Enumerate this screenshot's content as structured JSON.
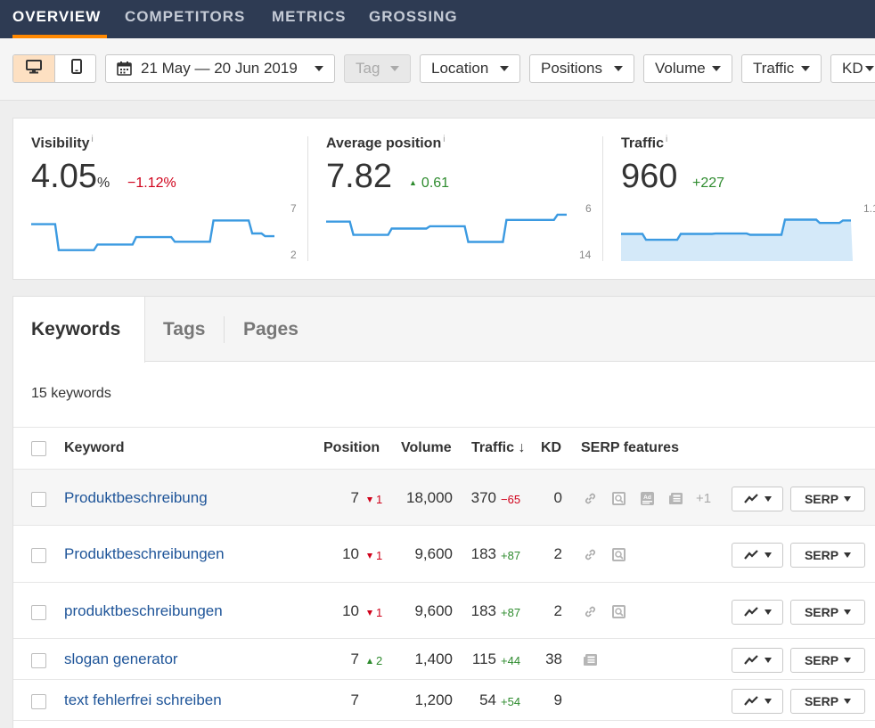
{
  "nav": {
    "items": [
      "OVERVIEW",
      "COMPETITORS",
      "METRICS",
      "GROSSING"
    ],
    "active": "OVERVIEW"
  },
  "toolbar": {
    "devices": [
      "desktop-icon",
      "mobile-icon"
    ],
    "date_range": "21 May — 20 Jun 2019",
    "tag": "Tag",
    "location": "Location",
    "positions": "Positions",
    "volume": "Volume",
    "traffic": "Traffic",
    "kd": "KD"
  },
  "overview": {
    "visibility": {
      "title": "Visibility",
      "info": "i",
      "value": "4.05",
      "unit": "%",
      "delta": "−1.12%",
      "axis_top": "7",
      "axis_bottom": "2",
      "series": [
        5.6,
        5.6,
        2.8,
        2.8,
        2.8,
        3.4,
        3.4,
        3.4,
        4.2,
        4.2,
        4.2,
        3.7,
        3.7,
        3.7,
        6.0,
        6.0,
        6.0,
        4.6,
        4.3
      ]
    },
    "avg_position": {
      "title": "Average position",
      "info": "i",
      "value": "7.82",
      "delta": "0.61",
      "axis_top": "6",
      "axis_bottom": "14",
      "series": [
        7.8,
        7.8,
        10.1,
        10.1,
        10.1,
        9.0,
        9.0,
        9.0,
        8.6,
        8.6,
        8.6,
        11.3,
        11.3,
        11.3,
        7.5,
        7.5,
        7.5,
        7.5,
        6.6
      ]
    },
    "traffic": {
      "title": "Traffic",
      "info": "i",
      "value": "960",
      "delta": "+227",
      "axis_top": "1.1",
      "series": [
        560,
        560,
        420,
        420,
        420,
        560,
        560,
        560,
        570,
        570,
        570,
        540,
        540,
        540,
        900,
        900,
        900,
        820,
        820,
        880
      ]
    }
  },
  "keywords": {
    "tabs": [
      "Keywords",
      "Tags",
      "Pages"
    ],
    "count": "15 keywords",
    "headers": {
      "keyword": "Keyword",
      "position": "Position",
      "volume": "Volume",
      "traffic": "Traffic ↓",
      "kd": "KD",
      "serp": "SERP features"
    },
    "rows": [
      {
        "keyword": "Produktbeschreibung",
        "position": "7",
        "pos_change": "1",
        "pos_dir": "down",
        "volume": "18,000",
        "traffic": "370",
        "traffic_change": "−65",
        "traffic_dir": "neg",
        "kd": "0",
        "serp_icons": [
          "link-icon",
          "image-icon",
          "ad-icon",
          "news-icon"
        ],
        "serp_more": "+1",
        "serp_btn": "SERP"
      },
      {
        "keyword": "Produktbeschreibungen",
        "position": "10",
        "pos_change": "1",
        "pos_dir": "down",
        "volume": "9,600",
        "traffic": "183",
        "traffic_change": "+87",
        "traffic_dir": "pos",
        "kd": "2",
        "serp_icons": [
          "link-icon",
          "image-icon"
        ],
        "serp_more": "",
        "serp_btn": "SERP"
      },
      {
        "keyword": "produktbeschreibungen",
        "position": "10",
        "pos_change": "1",
        "pos_dir": "down",
        "volume": "9,600",
        "traffic": "183",
        "traffic_change": "+87",
        "traffic_dir": "pos",
        "kd": "2",
        "serp_icons": [
          "link-icon",
          "image-icon"
        ],
        "serp_more": "",
        "serp_btn": "SERP"
      },
      {
        "keyword": "slogan generator",
        "position": "7",
        "pos_change": "2",
        "pos_dir": "up",
        "volume": "1,400",
        "traffic": "115",
        "traffic_change": "+44",
        "traffic_dir": "pos",
        "kd": "38",
        "serp_icons": [
          "news-icon"
        ],
        "serp_more": "",
        "serp_btn": "SERP"
      },
      {
        "keyword": "text fehlerfrei schreiben",
        "position": "7",
        "pos_change": "",
        "pos_dir": "",
        "volume": "1,200",
        "traffic": "54",
        "traffic_change": "+54",
        "traffic_dir": "pos",
        "kd": "9",
        "serp_icons": [],
        "serp_more": "",
        "serp_btn": "SERP"
      }
    ]
  },
  "colors": {
    "nav_bg": "#2e3b53",
    "accent": "#ff8800",
    "link": "#1f5599",
    "negative": "#d0021b",
    "positive": "#2e8b2e",
    "spark": "#3b9ae1",
    "spark_fill": "#d4e9f9"
  }
}
